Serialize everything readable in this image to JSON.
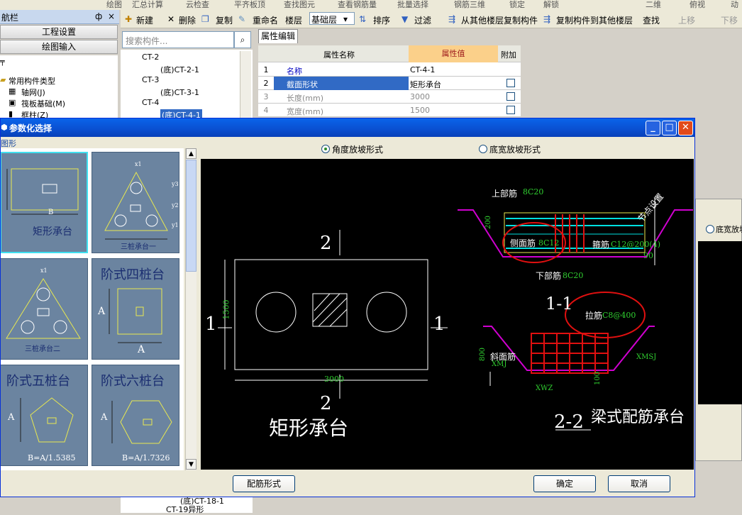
{
  "topbar": {
    "items": [
      "绘图",
      "汇总计算",
      "云检查",
      "平齐板顶",
      "查找图元",
      "查看钢筋量",
      "批量选择",
      "钢筋三维",
      "锁定",
      "解锁",
      "二维",
      "俯视",
      "动"
    ]
  },
  "nav": {
    "title": "航栏",
    "pin": "ф",
    "close": "×",
    "project_settings": "工程设置",
    "drawing_input": "绘图输入"
  },
  "left_tree": {
    "category": "常用构件类型",
    "items": [
      "轴网(J)",
      "筏板基础(M)",
      "框柱(Z)"
    ]
  },
  "toolbar": {
    "new": "新建",
    "delete": "删除",
    "copy": "复制",
    "rename": "重命名",
    "floor_label": "楼层",
    "floor_value": "基础层",
    "sort": "排序",
    "filter": "过滤",
    "copy_from": "从其他楼层复制构件",
    "copy_to": "复制构件到其他楼层",
    "find": "查找",
    "move_up": "上移",
    "move_down": "下移"
  },
  "search": {
    "placeholder": "搜索构件..."
  },
  "component_tree": {
    "items": [
      "CT-2",
      "(底)CT-2-1",
      "CT-3",
      "(底)CT-3-1",
      "CT-4",
      "(底)CT-4-1"
    ],
    "bottom_items": [
      "(底)CT-18-1",
      "CT-19异形"
    ]
  },
  "prop_editor": {
    "tab": "属性编辑",
    "headers": {
      "name": "属性名称",
      "value": "属性值",
      "extra": "附加"
    },
    "rows": [
      {
        "n": "1",
        "name": "名称",
        "value": "CT-4-1"
      },
      {
        "n": "2",
        "name": "截面形状",
        "value": "矩形承台"
      },
      {
        "n": "3",
        "name": "长度(mm)",
        "value": "3000"
      },
      {
        "n": "4",
        "name": "宽度(mm)",
        "value": "1500"
      }
    ]
  },
  "dialog": {
    "title": "参数化选择",
    "group_label": "图形",
    "radio1": "角度放坡形式",
    "radio2": "底宽放坡形式",
    "ok": "确定",
    "cancel": "取消",
    "rebar_form": "配筋形式"
  },
  "shapes": {
    "rect": "矩形承台",
    "tri1": "三桩承台一",
    "tri2": "三桩承台二",
    "step4": "阶式四桩台",
    "step5": "阶式五桩台",
    "step6": "阶式六桩台",
    "label_A": "A",
    "label_B": "B",
    "ratio5": "B=A/1.5385",
    "ratio6": "B=A/1.7326",
    "dim_x1": "x1",
    "dim_y1": "y1",
    "dim_y2": "y2",
    "dim_y3": "y3"
  },
  "cad": {
    "sec2": "2",
    "sec1": "1",
    "width": "1500",
    "length": "3000",
    "shape_name": "矩形承台",
    "top_bar": "上部筋",
    "top_bar_val": "8C20",
    "side_bar": "侧面筋",
    "side_bar_val": "8C12",
    "stirrup": "箍筋",
    "stirrup_val": "C12@200(4)",
    "bottom_bar": "下部筋",
    "bottom_bar_val": "8C20",
    "slope_set": "节点设置",
    "angle": "90",
    "height": "200",
    "sec11": "1-1",
    "tie_bar": "拉筋",
    "tie_bar_val": "C8@400",
    "slope_bar": "斜面筋",
    "xmj": "XMJ",
    "xmsj": "XMSJ",
    "xwz": "XWZ",
    "h800": "800",
    "h100": "100",
    "sec22": "2-2",
    "beam_type": "梁式配筋承台"
  },
  "behind": {
    "radio": "底宽放坡"
  }
}
